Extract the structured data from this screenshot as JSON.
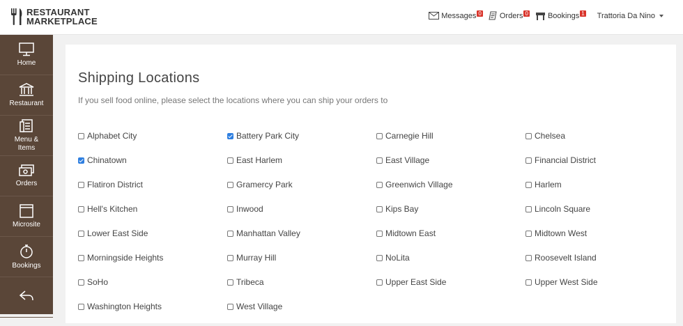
{
  "brand": {
    "line1": "RESTAURANT",
    "line2": "MARKETPLACE"
  },
  "topnav": {
    "messages": {
      "label": "Messages",
      "badge": "0"
    },
    "orders": {
      "label": "Orders",
      "badge": "0"
    },
    "bookings": {
      "label": "Bookings",
      "badge": "1"
    },
    "user": "Trattoria Da Nino"
  },
  "sidebar": {
    "items": [
      {
        "label": "Home",
        "icon": "monitor-icon"
      },
      {
        "label": "Restaurant",
        "icon": "building-icon"
      },
      {
        "label": "Menu &\nItems",
        "icon": "menu-icon"
      },
      {
        "label": "Orders",
        "icon": "cash-icon"
      },
      {
        "label": "Microsite",
        "icon": "window-icon"
      },
      {
        "label": "Bookings",
        "icon": "stopwatch-icon"
      },
      {
        "label": "",
        "icon": "back-icon"
      }
    ]
  },
  "page": {
    "title": "Shipping Locations",
    "subtitle": "If you sell food online, please select the locations where you can ship your orders to"
  },
  "locations": [
    {
      "name": "Alphabet City",
      "checked": false
    },
    {
      "name": "Battery Park City",
      "checked": true
    },
    {
      "name": "Carnegie Hill",
      "checked": false
    },
    {
      "name": "Chelsea",
      "checked": false
    },
    {
      "name": "Chinatown",
      "checked": true
    },
    {
      "name": "East Harlem",
      "checked": false
    },
    {
      "name": "East Village",
      "checked": false
    },
    {
      "name": "Financial District",
      "checked": false
    },
    {
      "name": "Flatiron District",
      "checked": false
    },
    {
      "name": "Gramercy Park",
      "checked": false
    },
    {
      "name": "Greenwich Village",
      "checked": false
    },
    {
      "name": "Harlem",
      "checked": false
    },
    {
      "name": "Hell's Kitchen",
      "checked": false
    },
    {
      "name": "Inwood",
      "checked": false
    },
    {
      "name": "Kips Bay",
      "checked": false
    },
    {
      "name": "Lincoln Square",
      "checked": false
    },
    {
      "name": "Lower East Side",
      "checked": false
    },
    {
      "name": "Manhattan Valley",
      "checked": false
    },
    {
      "name": "Midtown East",
      "checked": false
    },
    {
      "name": "Midtown West",
      "checked": false
    },
    {
      "name": "Morningside Heights",
      "checked": false
    },
    {
      "name": "Murray Hill",
      "checked": false
    },
    {
      "name": "NoLita",
      "checked": false
    },
    {
      "name": "Roosevelt Island",
      "checked": false
    },
    {
      "name": "SoHo",
      "checked": false
    },
    {
      "name": "Tribeca",
      "checked": false
    },
    {
      "name": "Upper East Side",
      "checked": false
    },
    {
      "name": "Upper West Side",
      "checked": false
    },
    {
      "name": "Washington Heights",
      "checked": false
    },
    {
      "name": "West Village",
      "checked": false
    }
  ]
}
